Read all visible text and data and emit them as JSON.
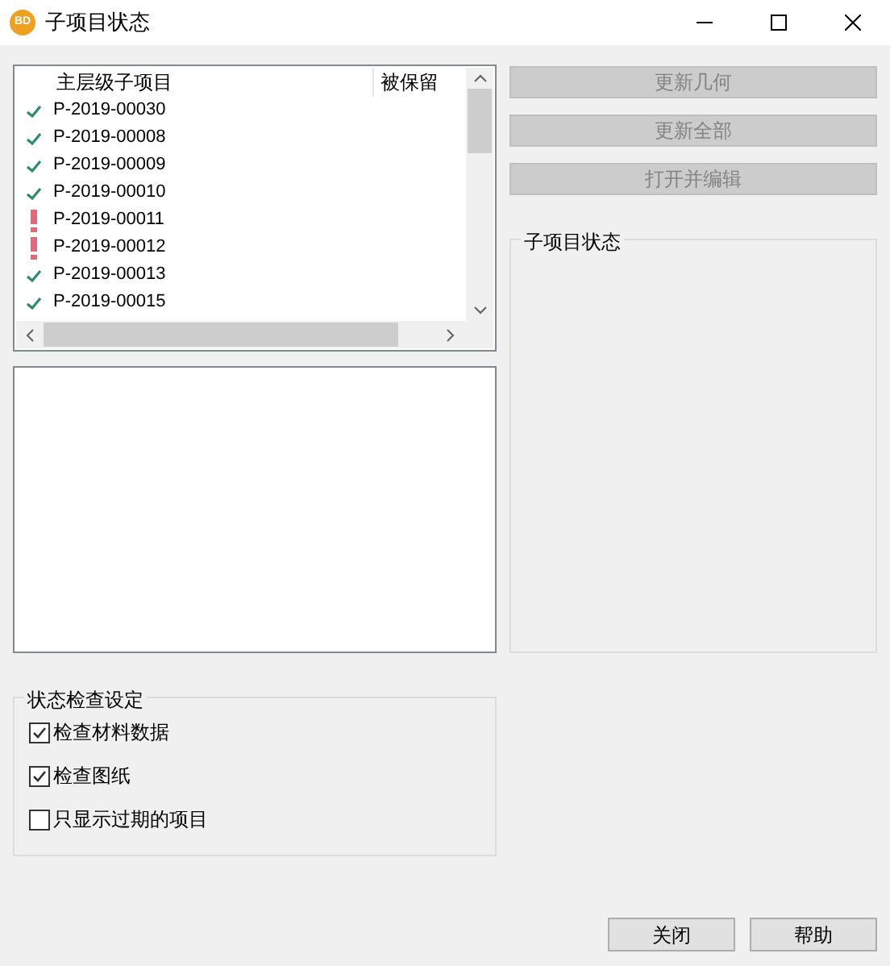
{
  "window": {
    "icon_text": "BD",
    "title": "子项目状态"
  },
  "list": {
    "columns": [
      "主层级子项目",
      "被保留"
    ],
    "rows": [
      {
        "kind": "ok",
        "name": "P-2019-00030"
      },
      {
        "kind": "ok",
        "name": "P-2019-00008"
      },
      {
        "kind": "ok",
        "name": "P-2019-00009"
      },
      {
        "kind": "ok",
        "name": "P-2019-00010"
      },
      {
        "kind": "warning",
        "name": "P-2019-00011"
      },
      {
        "kind": "warning",
        "name": "P-2019-00012"
      },
      {
        "kind": "ok",
        "name": "P-2019-00013"
      },
      {
        "kind": "ok",
        "name": "P-2019-00015"
      }
    ]
  },
  "actions": [
    {
      "label": "更新几何",
      "disabled": true
    },
    {
      "label": "更新全部",
      "disabled": true
    },
    {
      "label": "打开并编辑",
      "disabled": true
    }
  ],
  "status_group": {
    "title": "子项目状态"
  },
  "settings": {
    "title": "状态检查设定",
    "options": [
      {
        "label": "检查材料数据",
        "checked": true
      },
      {
        "label": "检查图纸",
        "checked": true
      },
      {
        "label": "只显示过期的项目",
        "checked": false
      }
    ]
  },
  "footer_buttons": [
    "关闭",
    "帮助"
  ]
}
